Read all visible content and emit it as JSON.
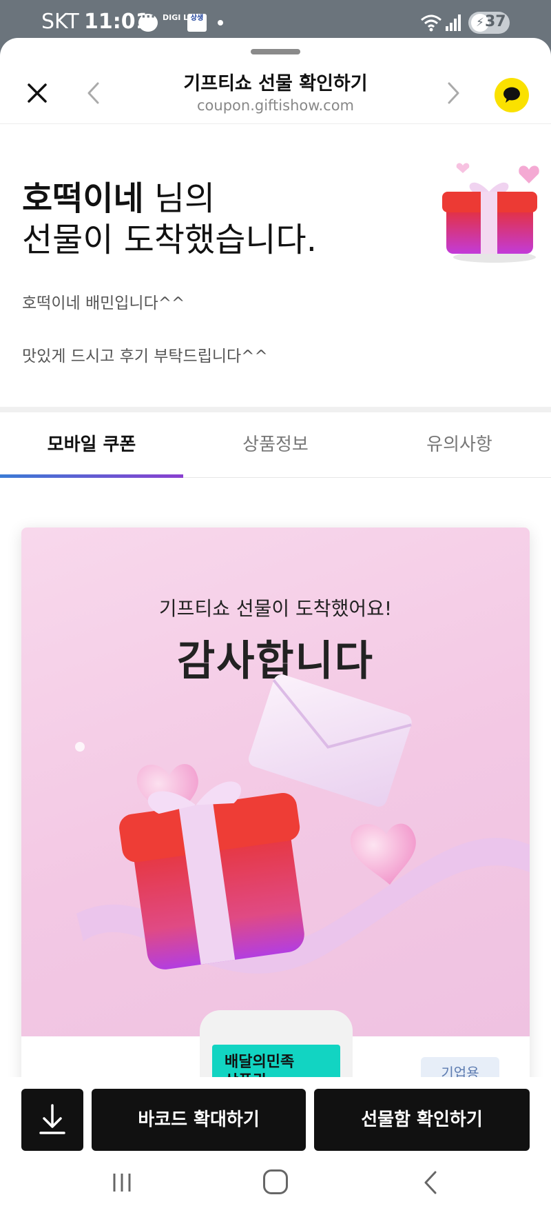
{
  "status_bar": {
    "carrier": "SKT",
    "time": "11:01",
    "digi_badge": "DIGI LOCA",
    "ss_badge": "상생",
    "battery": "37"
  },
  "header": {
    "title": "기프티쇼 선물 확인하기",
    "url": "coupon.giftishow.com"
  },
  "hero": {
    "sender_name": "호떡이네",
    "sender_suffix": " 님의",
    "line2": "선물이 도착했습니다.",
    "message_line1": "호떡이네 배민입니다^^",
    "message_line2": "맛있게 드시고 후기 부탁드립니다^^"
  },
  "tabs": [
    {
      "label": "모바일 쿠폰",
      "active": true
    },
    {
      "label": "상품정보",
      "active": false
    },
    {
      "label": "유의사항",
      "active": false
    }
  ],
  "card": {
    "banner_sub": "기프티쇼 선물이 도착했어요!",
    "banner_main": "감사합니다",
    "product_line1": "배달의민족",
    "product_line2": "상품권",
    "corp_badge": "기업용"
  },
  "actions": {
    "barcode_label": "바코드 확대하기",
    "giftbox_label": "선물함 확인하기"
  },
  "icons": {
    "close": "close-icon",
    "prev": "chevron-left-icon",
    "next": "chevron-right-icon",
    "kakao": "kakao-talk-icon",
    "download": "download-icon"
  },
  "colors": {
    "kakao_yellow": "#fae100",
    "tab_indicator_start": "#3a7bd5",
    "tab_indicator_end": "#8a3fd0",
    "button_dark": "#111111",
    "product_teal": "#12d4c2"
  }
}
